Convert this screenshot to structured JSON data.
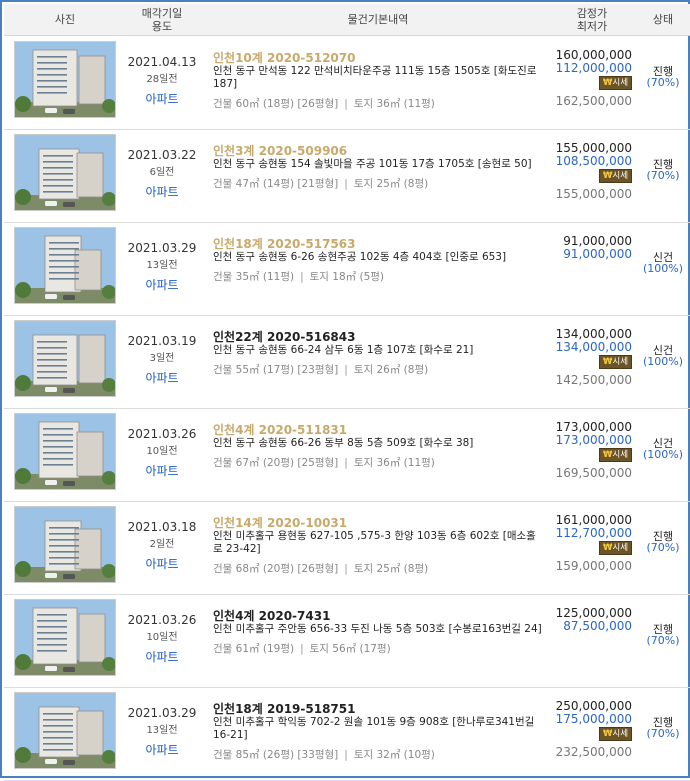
{
  "header": {
    "photo": "사진",
    "date_line1": "매각기일",
    "date_line2": "용도",
    "info": "물건기본내역",
    "price_line1": "감정가",
    "price_line2": "최저가",
    "status": "상태"
  },
  "market_badge": {
    "icon": "₩",
    "label": "시세"
  },
  "rows": [
    {
      "date": "2021.04.13",
      "ago": "28일전",
      "usage": "아파트",
      "case": "인천10계 2020-512070",
      "case_highlight": true,
      "address": "인천 동구 만석동 122 만석비치타운주공 111동 15층 1505호 [화도진로 187]",
      "building": "건물 60㎡ (18평) [26평형]",
      "land": "토지 36㎡ (11평)",
      "appraisal": "160,000,000",
      "minimum": "112,000,000",
      "market": "162,500,000",
      "status": "진행",
      "pct": "(70%)"
    },
    {
      "date": "2021.03.22",
      "ago": "6일전",
      "usage": "아파트",
      "case": "인천3계 2020-509906",
      "case_highlight": true,
      "address": "인천 동구 송현동 154 솔빛마을 주공 101동 17층 1705호 [송현로 50]",
      "building": "건물 47㎡ (14평) [21평형]",
      "land": "토지 25㎡ (8평)",
      "appraisal": "155,000,000",
      "minimum": "108,500,000",
      "market": "155,000,000",
      "status": "진행",
      "pct": "(70%)"
    },
    {
      "date": "2021.03.29",
      "ago": "13일전",
      "usage": "아파트",
      "case": "인천18계 2020-517563",
      "case_highlight": true,
      "address": "인천 동구 송현동 6-26 송현주공 102동 4층 404호 [인중로 653]",
      "building": "건물 35㎡ (11평)",
      "land": "토지 18㎡ (5평)",
      "appraisal": "91,000,000",
      "minimum": "91,000,000",
      "market": "",
      "status": "신건",
      "pct": "(100%)"
    },
    {
      "date": "2021.03.19",
      "ago": "3일전",
      "usage": "아파트",
      "case": "인천22계 2020-516843",
      "case_highlight": false,
      "address": "인천 동구 송현동 66-24 삼두 6동 1층 107호 [화수로 21]",
      "building": "건물 55㎡ (17평) [23평형]",
      "land": "토지 26㎡ (8평)",
      "appraisal": "134,000,000",
      "minimum": "134,000,000",
      "market": "142,500,000",
      "status": "신건",
      "pct": "(100%)"
    },
    {
      "date": "2021.03.26",
      "ago": "10일전",
      "usage": "아파트",
      "case": "인천4계 2020-511831",
      "case_highlight": true,
      "address": "인천 동구 송현동 66-26 동부 8동 5층 509호 [화수로 38]",
      "building": "건물 67㎡ (20평) [25평형]",
      "land": "토지 36㎡ (11평)",
      "appraisal": "173,000,000",
      "minimum": "173,000,000",
      "market": "169,500,000",
      "status": "신건",
      "pct": "(100%)"
    },
    {
      "date": "2021.03.18",
      "ago": "2일전",
      "usage": "아파트",
      "case": "인천14계 2020-10031",
      "case_highlight": true,
      "address": "인천 미추홀구 용현동 627-105 ,575-3 한양 103동 6층 602호 [매소홀로 23-42]",
      "building": "건물 68㎡ (20평) [26평형]",
      "land": "토지 25㎡ (8평)",
      "appraisal": "161,000,000",
      "minimum": "112,700,000",
      "market": "159,000,000",
      "status": "진행",
      "pct": "(70%)"
    },
    {
      "date": "2021.03.26",
      "ago": "10일전",
      "usage": "아파트",
      "case": "인천4계 2020-7431",
      "case_highlight": false,
      "address": "인천 미추홀구 주안동 656-33 두진 나동 5층 503호 [수봉로163번길 24]",
      "building": "건물 61㎡ (19평)",
      "land": "토지 56㎡ (17평)",
      "appraisal": "125,000,000",
      "minimum": "87,500,000",
      "market": "",
      "status": "진행",
      "pct": "(70%)"
    },
    {
      "date": "2021.03.29",
      "ago": "13일전",
      "usage": "아파트",
      "case": "인천18계 2019-518751",
      "case_highlight": false,
      "address": "인천 미추홀구 학익동 702-2 원솔 101동 9층 908호 [한나루로341번길 16-21]",
      "building": "건물 85㎡ (26평) [33평형]",
      "land": "토지 32㎡ (10평)",
      "appraisal": "250,000,000",
      "minimum": "175,000,000",
      "market": "232,500,000",
      "status": "진행",
      "pct": "(70%)"
    }
  ]
}
